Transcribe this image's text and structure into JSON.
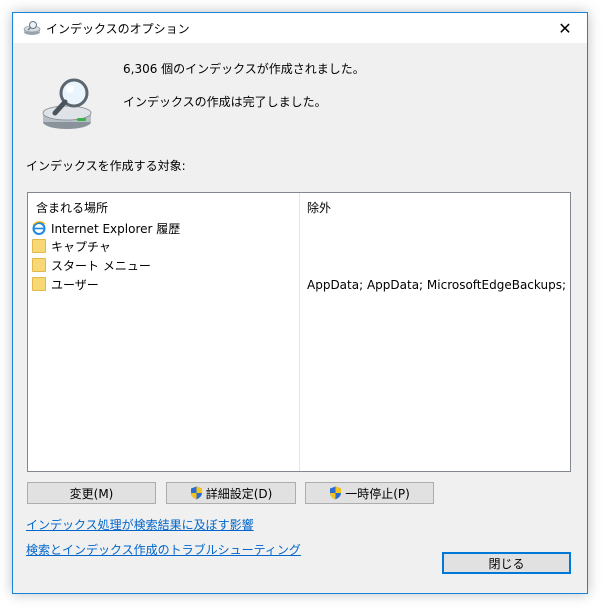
{
  "window": {
    "title": "インデックスのオプション",
    "close_glyph": "✕"
  },
  "status": {
    "line1": "6,306 個のインデックスが作成されました。",
    "line2": "インデックスの作成は完了しました。"
  },
  "section_label": "インデックスを作成する対象:",
  "list": {
    "columns": {
      "included": "含まれる場所",
      "excluded": "除外"
    },
    "rows": [
      {
        "location": "Internet Explorer 履歴",
        "icon": "ie-icon",
        "exclude": ""
      },
      {
        "location": "キャプチャ",
        "icon": "folder-icon",
        "exclude": ""
      },
      {
        "location": "スタート メニュー",
        "icon": "folder-icon",
        "exclude": ""
      },
      {
        "location": "ユーザー",
        "icon": "folder-icon",
        "exclude": "AppData; AppData; MicrosoftEdgeBackups; Mi..."
      }
    ]
  },
  "buttons": {
    "modify": "変更(M)",
    "advanced": "詳細設定(D)",
    "pause": "一時停止(P)",
    "close": "閉じる"
  },
  "links": {
    "affect": "インデックス処理が検索結果に及ぼす影響",
    "troubleshoot": "検索とインデックス作成のトラブルシューティング"
  },
  "colors": {
    "accent": "#0078d7",
    "link": "#0066cc",
    "folder": "#f8d775",
    "shield_blue": "#2b6cd1",
    "shield_yellow": "#f4c21b"
  }
}
